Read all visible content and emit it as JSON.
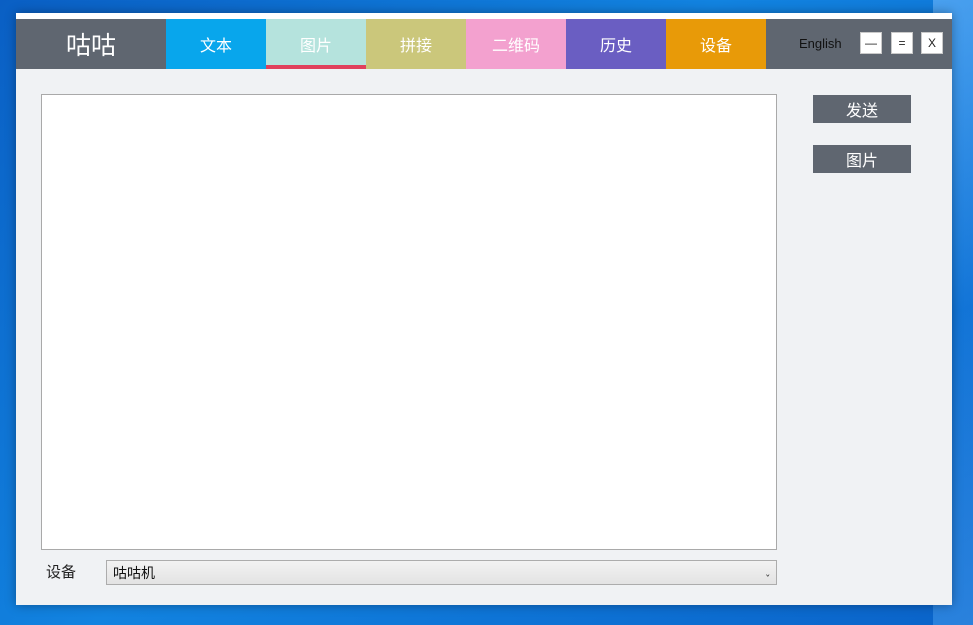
{
  "app": {
    "title": "咕咕"
  },
  "tabs": [
    {
      "label": "文本",
      "color": "#08a6ec",
      "active": false
    },
    {
      "label": "图片",
      "color": "#b5e3dd",
      "active": true,
      "underline": "#e0405c"
    },
    {
      "label": "拼接",
      "color": "#cbc77b",
      "active": false
    },
    {
      "label": "二维码",
      "color": "#f3a1cf",
      "active": false
    },
    {
      "label": "历史",
      "color": "#6a5ec2",
      "active": false
    },
    {
      "label": "设备",
      "color": "#e89a08",
      "active": false
    }
  ],
  "header": {
    "language_label": "English",
    "minimize_label": "—",
    "maximize_label": "=",
    "close_label": "X"
  },
  "actions": {
    "send_label": "发送",
    "image_label": "图片"
  },
  "device": {
    "label": "设备",
    "selected": "咕咕机"
  },
  "colors": {
    "header_bg": "#5f6670",
    "window_bg": "#f0f2f4",
    "button_bg": "#5f6670"
  }
}
